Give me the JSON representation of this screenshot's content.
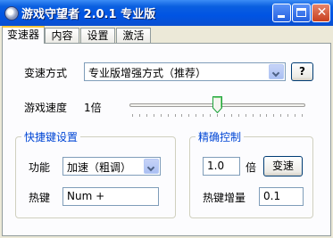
{
  "window": {
    "title": "游戏守望者 2.0.1 专业版",
    "close_glyph": "✕"
  },
  "tabs": [
    {
      "label": "变速器",
      "active": true
    },
    {
      "label": "内容",
      "active": false
    },
    {
      "label": "设置",
      "active": false
    },
    {
      "label": "激活",
      "active": false
    }
  ],
  "speed_mode": {
    "label": "变速方式",
    "value": "专业版增强方式（推荐）",
    "help_label": "?"
  },
  "game_speed": {
    "label": "游戏速度",
    "value_text": "1倍",
    "slider_fraction": 0.5,
    "tick_count": 25
  },
  "hotkey_group": {
    "title": "快捷键设置",
    "function_label": "功能",
    "function_value": "加速（粗调）",
    "hotkey_label": "热键",
    "hotkey_value": "Num +"
  },
  "precise_group": {
    "title": "精确控制",
    "multiplier_value": "1.0",
    "multiplier_unit": "倍",
    "apply_button": "变速",
    "increment_label": "热键增量",
    "increment_value": "0.1"
  }
}
